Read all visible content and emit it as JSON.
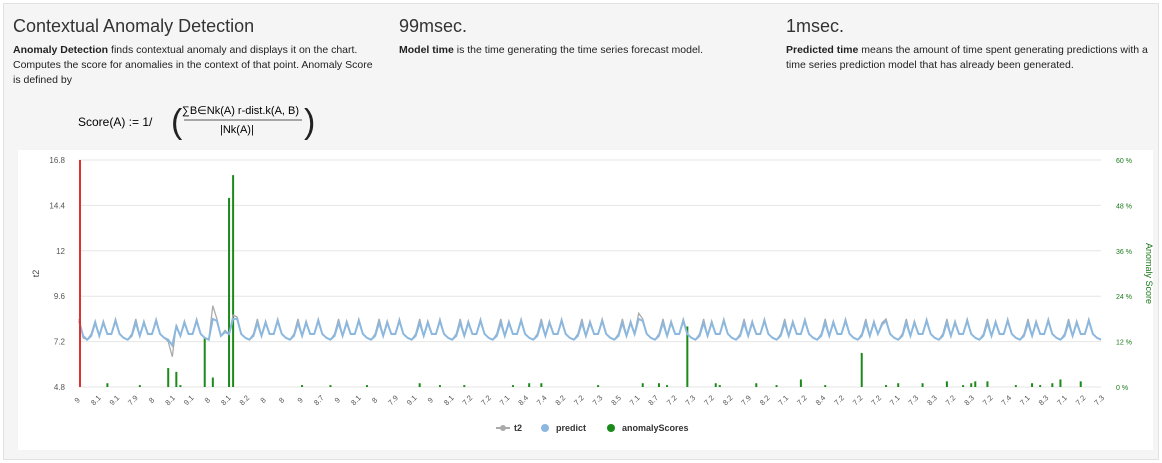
{
  "header": {
    "title": "Contextual Anomaly Detection",
    "desc_bold": "Anomaly Detection",
    "desc_rest": " finds contextual anomaly and displays it on the chart. Computes the score for anomalies in the context of that point. Anomaly Score is defined by",
    "formula_lhs": "Score(A) := 1/",
    "formula_num": "∑B∈Nk(A) r-dist.k(A, B)",
    "formula_den": "|Nk(A)|"
  },
  "model": {
    "title": "99msec.",
    "desc_bold": "Model time",
    "desc_rest": " is the time generating the time series forecast model."
  },
  "predicted": {
    "title": "1msec.",
    "desc_bold": "Predicted time",
    "desc_rest": " means the amount of time spent generating predictions with a time series prediction model that has already been generated."
  },
  "chart_data": {
    "type": "line",
    "ylabel": "t2",
    "y2label": "Anomaly Score",
    "ylim": [
      4.8,
      16.8
    ],
    "yticks": [
      "16.8",
      "14.4",
      "12",
      "9.6",
      "7.2",
      "4.8"
    ],
    "y2lim": [
      0,
      60
    ],
    "y2ticks": [
      "60 %",
      "48 %",
      "36 %",
      "24 %",
      "12 %",
      "0 %"
    ],
    "grid": true,
    "legend_position": "bottom",
    "colors": {
      "t2": "#aaaaaa",
      "predict": "#8cb8df",
      "anomalyScores": "#1a8a1a",
      "marker": "#e03030"
    },
    "xticklabels": [
      "9",
      "8.1",
      "9.1",
      "7.9",
      "8",
      "8.1",
      "9.1",
      "8",
      "8.1",
      "8.2",
      "8",
      "8",
      "9",
      "8.7",
      "9",
      "8.1",
      "8",
      "7.9",
      "9.1",
      "9",
      "8.1",
      "7.2",
      "7.2",
      "7.1",
      "8.4",
      "7.4",
      "8.2",
      "7.2",
      "7.3",
      "8.5",
      "7.1",
      "8.7",
      "7.2",
      "7.3",
      "7.2",
      "8.2",
      "7.9",
      "8.2",
      "7.1",
      "7.2",
      "8.4",
      "7.2",
      "7.2",
      "7.2",
      "7.1",
      "7.3",
      "8.3",
      "7.2",
      "8.3",
      "7.2",
      "7.4",
      "7.1",
      "8.3",
      "7.1",
      "7.2",
      "7.3"
    ],
    "series": [
      {
        "name": "t2",
        "values": [
          8.4,
          7.4,
          7.3,
          7.6,
          8.3,
          7.5,
          8.3,
          7.6,
          7.6,
          8.4,
          7.6,
          7.4,
          7.3,
          7.6,
          8.4,
          7.5,
          8.3,
          7.6,
          7.6,
          8.4,
          7.6,
          7.4,
          7.2,
          6.4,
          8.1,
          7.5,
          8.3,
          7.6,
          7.6,
          8.4,
          7.6,
          7.4,
          7.3,
          9.1,
          8.4,
          7.5,
          7.8,
          7.6,
          8.6,
          8.5,
          7.6,
          7.4,
          7.3,
          7.6,
          8.4,
          7.5,
          8.3,
          7.6,
          7.6,
          8.4,
          7.6,
          7.4,
          7.3,
          7.6,
          8.4,
          7.5,
          8.3,
          7.6,
          7.6,
          8.4,
          7.6,
          7.4,
          7.3,
          7.6,
          8.4,
          7.5,
          8.3,
          7.6,
          7.6,
          8.4,
          7.6,
          7.4,
          7.3,
          7.6,
          8.4,
          7.5,
          8.3,
          7.6,
          7.6,
          8.4,
          7.6,
          7.4,
          7.3,
          7.6,
          8.4,
          7.5,
          8.3,
          7.6,
          7.6,
          8.4,
          7.6,
          7.4,
          7.3,
          7.6,
          8.4,
          7.5,
          8.3,
          7.6,
          7.6,
          8.4,
          7.6,
          7.4,
          7.3,
          7.6,
          8.4,
          7.5,
          8.3,
          7.6,
          7.6,
          8.4,
          7.6,
          7.4,
          7.3,
          7.6,
          8.4,
          7.5,
          8.3,
          7.6,
          7.6,
          8.4,
          7.6,
          7.4,
          7.3,
          7.6,
          8.4,
          7.5,
          8.3,
          7.6,
          7.6,
          8.4,
          7.6,
          7.4,
          7.3,
          7.6,
          8.4,
          7.5,
          8.3,
          7.6,
          8.7,
          8.4,
          7.6,
          7.4,
          7.3,
          7.6,
          8.4,
          7.5,
          8.3,
          7.6,
          7.6,
          8.4,
          7.6,
          7.4,
          7.3,
          7.6,
          8.4,
          7.5,
          8.3,
          7.6,
          7.6,
          8.4,
          7.6,
          7.4,
          7.3,
          7.6,
          8.4,
          7.5,
          8.3,
          7.6,
          7.6,
          8.4,
          7.6,
          7.4,
          7.3,
          7.6,
          8.4,
          7.5,
          8.3,
          7.6,
          7.6,
          8.4,
          7.6,
          7.4,
          7.3,
          7.6,
          8.4,
          7.5,
          8.3,
          7.6,
          7.6,
          8.4,
          7.6,
          7.4,
          7.3,
          7.6,
          8.4,
          7.5,
          8.3,
          7.6,
          8.2,
          8.4,
          7.6,
          7.4,
          7.3,
          7.6,
          8.4,
          7.5,
          8.3,
          7.6,
          7.6,
          8.4,
          7.6,
          7.4,
          7.3,
          7.6,
          8.4,
          7.5,
          8.3,
          7.6,
          7.6,
          8.4,
          7.6,
          7.4,
          7.3,
          7.6,
          8.4,
          7.5,
          8.3,
          7.6,
          7.6,
          8.4,
          7.6,
          7.4,
          7.3,
          7.6,
          8.4,
          7.5,
          8.3,
          7.6,
          7.6,
          8.4,
          7.6,
          7.4,
          7.3,
          7.6,
          8.4,
          7.5,
          8.3,
          7.6,
          7.6,
          8.4,
          7.6,
          7.4,
          7.3
        ]
      },
      {
        "name": "predict",
        "values": [
          8.3,
          7.5,
          7.3,
          7.5,
          8.2,
          7.5,
          8.2,
          7.6,
          7.6,
          8.3,
          7.6,
          7.4,
          7.3,
          7.5,
          8.2,
          7.5,
          8.2,
          7.6,
          7.6,
          8.3,
          7.6,
          7.4,
          7.3,
          7.0,
          8.0,
          7.5,
          8.2,
          7.6,
          7.6,
          8.3,
          7.6,
          7.4,
          7.3,
          8.4,
          8.3,
          7.5,
          7.7,
          7.6,
          8.4,
          8.4,
          7.6,
          7.4,
          7.3,
          7.5,
          8.2,
          7.5,
          8.2,
          7.6,
          7.6,
          8.3,
          7.6,
          7.4,
          7.3,
          7.5,
          8.2,
          7.5,
          8.2,
          7.6,
          7.6,
          8.3,
          7.6,
          7.4,
          7.3,
          7.5,
          8.2,
          7.5,
          8.2,
          7.6,
          7.6,
          8.3,
          7.6,
          7.4,
          7.3,
          7.5,
          8.2,
          7.5,
          8.2,
          7.6,
          7.6,
          8.3,
          7.6,
          7.4,
          7.3,
          7.5,
          8.2,
          7.5,
          8.2,
          7.6,
          7.6,
          8.3,
          7.6,
          7.4,
          7.3,
          7.5,
          8.2,
          7.5,
          8.2,
          7.6,
          7.6,
          8.3,
          7.6,
          7.4,
          7.3,
          7.5,
          8.2,
          7.5,
          8.2,
          7.6,
          7.6,
          8.3,
          7.6,
          7.4,
          7.3,
          7.5,
          8.2,
          7.5,
          8.2,
          7.6,
          7.6,
          8.3,
          7.6,
          7.4,
          7.3,
          7.5,
          8.2,
          7.5,
          8.2,
          7.6,
          7.6,
          8.3,
          7.6,
          7.4,
          7.3,
          7.5,
          8.2,
          7.5,
          8.2,
          7.6,
          8.4,
          8.3,
          7.6,
          7.4,
          7.3,
          7.5,
          8.2,
          7.5,
          8.2,
          7.6,
          7.6,
          8.3,
          7.6,
          7.4,
          7.3,
          7.5,
          8.2,
          7.5,
          8.2,
          7.6,
          7.6,
          8.3,
          7.6,
          7.4,
          7.3,
          7.5,
          8.2,
          7.5,
          8.2,
          7.6,
          7.6,
          8.3,
          7.6,
          7.4,
          7.3,
          7.5,
          8.2,
          7.5,
          8.2,
          7.6,
          7.6,
          8.3,
          7.6,
          7.4,
          7.3,
          7.5,
          8.2,
          7.5,
          8.2,
          7.6,
          7.6,
          8.3,
          7.6,
          7.4,
          7.3,
          7.5,
          8.2,
          7.5,
          8.2,
          7.6,
          8.1,
          8.3,
          7.6,
          7.4,
          7.3,
          7.5,
          8.2,
          7.5,
          8.2,
          7.6,
          7.6,
          8.3,
          7.6,
          7.4,
          7.3,
          7.5,
          8.2,
          7.5,
          8.2,
          7.6,
          7.6,
          8.3,
          7.6,
          7.4,
          7.3,
          7.5,
          8.2,
          7.5,
          8.2,
          7.6,
          7.6,
          8.3,
          7.6,
          7.4,
          7.3,
          7.5,
          8.2,
          7.5,
          8.2,
          7.6,
          7.6,
          8.3,
          7.6,
          7.4,
          7.3,
          7.5,
          8.2,
          7.5,
          8.2,
          7.6,
          7.6,
          8.3,
          7.6,
          7.4,
          7.3
        ]
      },
      {
        "name": "anomalyScores",
        "values": [
          0,
          0,
          0,
          0,
          0,
          0,
          0,
          0,
          0,
          0,
          0,
          0,
          0,
          0,
          0,
          0,
          0,
          0,
          0,
          0,
          0,
          0,
          0,
          0,
          0,
          0,
          0,
          0,
          0,
          0,
          0,
          0,
          0,
          0,
          0,
          0,
          0,
          0,
          0,
          0,
          0,
          0,
          0,
          0,
          0,
          0,
          0,
          0,
          0,
          0,
          0,
          0,
          0,
          0,
          0,
          0,
          0,
          0,
          0,
          0,
          0,
          0,
          0,
          0,
          0,
          0,
          0,
          0,
          0,
          0,
          0,
          0,
          0,
          0,
          0,
          0,
          0,
          0,
          0,
          0,
          0,
          0,
          0,
          0,
          0,
          0,
          0,
          0,
          0,
          0,
          0,
          0,
          0,
          0,
          0,
          0,
          0,
          0,
          0,
          0,
          0,
          0,
          0,
          0,
          0,
          0,
          0,
          0,
          0,
          0,
          0,
          0,
          0,
          0,
          0,
          0,
          0,
          0,
          0,
          0,
          0,
          0,
          0,
          0,
          0,
          0,
          0,
          0,
          0,
          0,
          0,
          0,
          0,
          0,
          0,
          0,
          0,
          0,
          0,
          0,
          0,
          0,
          0,
          0,
          0,
          0,
          0,
          0,
          0,
          0,
          0,
          0,
          0,
          0,
          0,
          0,
          0,
          0,
          0,
          0,
          0,
          0,
          0,
          0,
          0,
          0,
          0,
          0,
          0,
          0,
          0,
          0,
          0,
          0,
          0,
          0,
          0,
          0,
          0,
          0,
          0,
          0,
          0,
          0,
          0,
          0,
          0,
          0,
          0,
          0,
          0,
          0,
          0,
          0,
          0,
          0,
          0,
          0,
          0,
          0,
          0,
          0,
          0,
          0,
          0,
          0,
          0,
          0,
          0,
          0,
          0,
          0,
          0,
          0,
          0,
          0,
          0,
          0,
          0,
          0,
          0,
          0,
          0,
          0,
          0,
          0,
          0,
          0,
          0,
          0,
          0,
          0,
          0,
          0,
          0,
          0,
          0,
          0,
          0,
          0,
          0,
          0,
          0,
          0,
          0,
          0,
          0,
          0,
          0,
          0,
          0,
          0,
          0,
          0,
          0,
          0,
          0,
          0,
          0,
          0,
          0,
          0,
          0,
          0,
          0,
          0,
          0,
          0,
          0,
          0,
          0,
          0,
          0
        ]
      }
    ],
    "anomaly_spikes": [
      [
        7,
        1
      ],
      [
        15,
        0.5
      ],
      [
        22,
        5
      ],
      [
        24,
        4
      ],
      [
        25,
        0.5
      ],
      [
        31,
        13
      ],
      [
        33,
        2.5
      ],
      [
        37,
        50
      ],
      [
        38,
        56
      ],
      [
        55,
        0.5
      ],
      [
        62,
        0.5
      ],
      [
        71,
        0.5
      ],
      [
        84,
        1
      ],
      [
        89,
        0.5
      ],
      [
        95,
        0.5
      ],
      [
        107,
        0.5
      ],
      [
        111,
        1
      ],
      [
        114,
        1
      ],
      [
        128,
        0.5
      ],
      [
        139,
        1
      ],
      [
        143,
        1
      ],
      [
        145,
        0.5
      ],
      [
        150,
        16
      ],
      [
        157,
        1
      ],
      [
        158,
        0.5
      ],
      [
        167,
        1
      ],
      [
        172,
        0.5
      ],
      [
        178,
        2
      ],
      [
        184,
        0.5
      ],
      [
        193,
        9
      ],
      [
        199,
        0.5
      ],
      [
        202,
        1
      ],
      [
        208,
        1
      ],
      [
        214,
        1.5
      ],
      [
        218,
        0.5
      ],
      [
        220,
        1
      ],
      [
        221,
        1.5
      ],
      [
        224,
        1.5
      ],
      [
        231,
        0.5
      ],
      [
        235,
        1
      ],
      [
        237,
        0.5
      ],
      [
        240,
        1
      ],
      [
        242,
        2
      ],
      [
        247,
        1.5
      ]
    ],
    "marker_index": 0,
    "legend": [
      "t2",
      "predict",
      "anomalyScores"
    ]
  }
}
